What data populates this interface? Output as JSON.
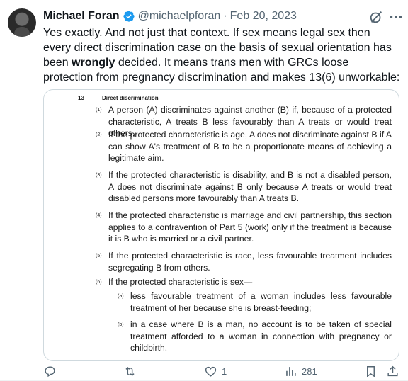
{
  "tweet": {
    "name": "Michael Foran",
    "handle": "@michaelpforan",
    "separator": "·",
    "date": "Feb 20, 2023",
    "text_part1": "Yes exactly. And not just that context. If sex means legal sex then every direct discrimination case on the basis of sexual orientation has been ",
    "text_bold": "wrongly",
    "text_part2": " decided. It means trans men with GRCs loose protection from pregnancy discrimination and makes  13(6) unworkable:",
    "verified_icon": "verified-badge-icon",
    "accent_color": "#1d9bf0"
  },
  "document": {
    "section_number": "13",
    "section_title": "Direct discrimination",
    "paragraphs": [
      {
        "num": "(1)",
        "text": "A person (A) discriminates against another (B) if, because of a protected characteristic, A treats B less favourably than A treats or would treat others."
      },
      {
        "num": "(2)",
        "text": "If the protected characteristic is age, A does not discriminate against B if A can show A's treatment of B to be a proportionate means of achieving a legitimate aim."
      },
      {
        "num": "(3)",
        "text": "If the protected characteristic is disability, and B is not a disabled person, A does not discriminate against B only because A treats or would treat disabled persons more favourably than A treats B."
      },
      {
        "num": "(4)",
        "text": "If the protected characteristic is marriage and civil partnership, this section applies to a contravention of Part 5 (work) only if the treatment is because it is B who is married or a civil partner."
      },
      {
        "num": "(5)",
        "text": "If the protected characteristic is race, less favourable treatment includes segregating B from others."
      },
      {
        "num": "(6)",
        "text": "If the protected characteristic is sex—"
      }
    ],
    "subparagraphs": [
      {
        "num": "(a)",
        "text": "less favourable treatment of a woman includes less favourable treatment of her because she is breast-feeding;"
      },
      {
        "num": "(b)",
        "text": "in a case where B is a man, no account is to be taken of special treatment afforded to a woman in connection with pregnancy or childbirth."
      }
    ]
  },
  "actions": {
    "reply": {
      "icon": "reply-icon",
      "count": ""
    },
    "retweet": {
      "icon": "retweet-icon",
      "count": ""
    },
    "like": {
      "icon": "heart-icon",
      "count": "1"
    },
    "views": {
      "icon": "views-icon",
      "count": "281"
    },
    "bookmark": {
      "icon": "bookmark-icon",
      "count": ""
    },
    "share": {
      "icon": "share-icon",
      "count": ""
    }
  }
}
